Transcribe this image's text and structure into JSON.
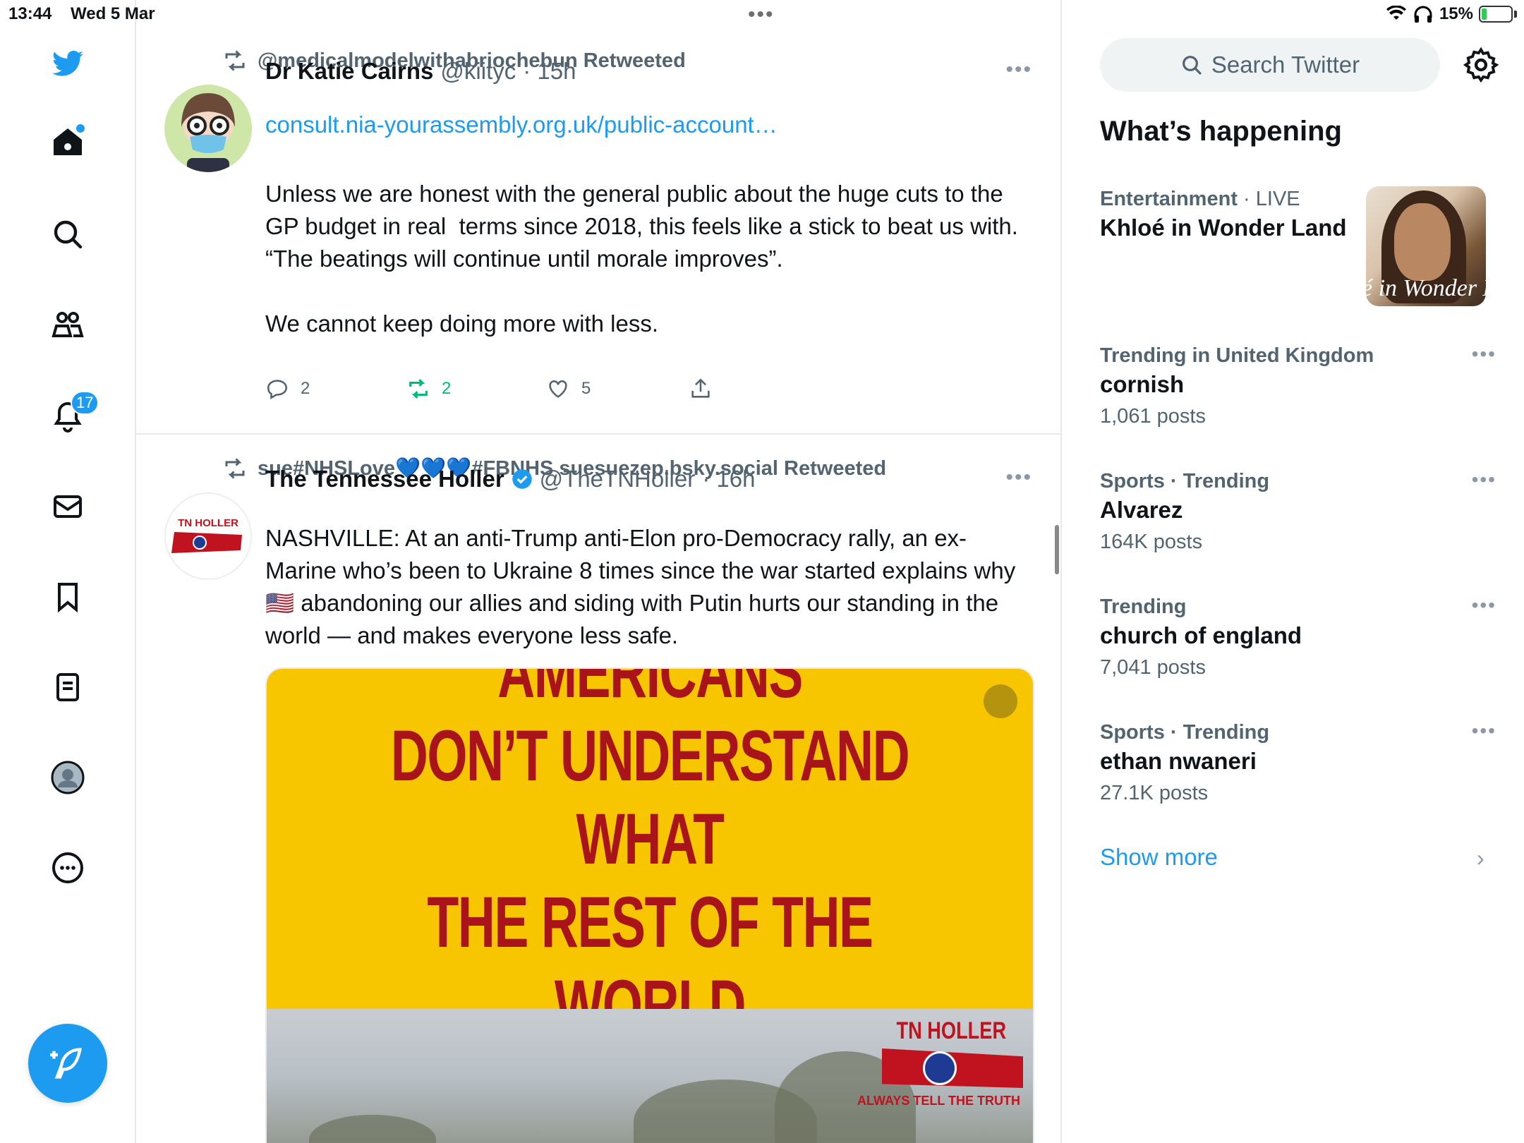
{
  "status_bar": {
    "time": "13:44",
    "date": "Wed 5 Mar",
    "battery": "15%"
  },
  "nav": {
    "notifications_count": "17",
    "items": [
      "home",
      "explore",
      "communities",
      "notifications",
      "messages",
      "bookmarks",
      "lists",
      "profile",
      "more"
    ]
  },
  "tweets": [
    {
      "retweeted_by": "@medicalmodelwithabriochebun Retweeted",
      "author_name": "Dr Katie Cairns",
      "author_handle": "@kiityc",
      "time": "· 15h",
      "link": "consult.nia-yourassembly.org.uk/public-account…",
      "body": "Unless we are honest with the general public about the huge cuts to the GP budget in real  terms since 2018, this feels like a stick to beat us with.\n“The beatings will continue until morale improves”.\n\nWe cannot keep doing more with less.",
      "replies": "2",
      "retweets": "2",
      "likes": "5"
    },
    {
      "retweeted_by": "sue#NHSLove💙💙💙#FBNHS suesuezep.bsky.social Retweeted",
      "author_name": "The Tennessee Holler",
      "author_handle": "@TheTNHoller",
      "time": "· 16h",
      "body": "NASHVILLE: At an anti-Trump anti-Elon pro-Democracy rally, an ex-Marine who’s been to Ukraine 8 times since the war started explains why 🇺🇸 abandoning our allies and siding with Putin hurts our standing in the world — and makes everyone less safe.",
      "media_quote": "“A LOT OF AMERICANS\nDON’T UNDERSTAND WHAT\nTHE REST OF THE WORLD\nLOOKS TO US FOR.”",
      "media_logo": "TN HOLLER",
      "media_tagline": "ALWAYS TELL THE TRUTH",
      "avatar_logo": "TN HOLLER"
    }
  ],
  "sidebar": {
    "search_placeholder": "Search Twitter",
    "section_title": "What’s happening",
    "trends": [
      {
        "category": "Entertainment",
        "extra": " · LIVE",
        "name": "Khloé in Wonder Land",
        "count": "",
        "image_watermark": "é in Wonder L"
      },
      {
        "category": "Trending in United Kingdom",
        "extra": "",
        "name": "cornish",
        "count": "1,061 posts"
      },
      {
        "category": "Sports · Trending",
        "extra": "",
        "name": "Alvarez",
        "count": "164K posts"
      },
      {
        "category": "Trending",
        "extra": "",
        "name": "church of england",
        "count": "7,041 posts"
      },
      {
        "category": "Sports · Trending",
        "extra": "",
        "name": "ethan nwaneri",
        "count": "27.1K posts"
      }
    ],
    "show_more": "Show more"
  },
  "colors": {
    "accent": "#1d9bf0",
    "retweet_green": "#00ba7c",
    "media_yellow": "#f7c600",
    "media_red": "#a8141a"
  }
}
